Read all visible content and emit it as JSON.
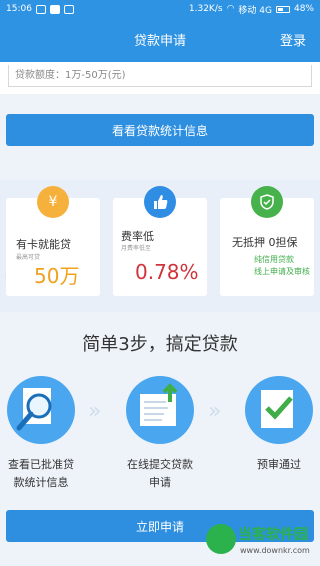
{
  "status_bar": {
    "time": "15:06",
    "network_speed": "1.32K/s",
    "carrier": "移动 4G",
    "battery": "48%"
  },
  "nav": {
    "title": "贷款申请",
    "login": "登录"
  },
  "form": {
    "amount_placeholder": "贷款额度：1万-50万(元)"
  },
  "buttons": {
    "stats": "看看贷款统计信息",
    "apply": "立即申请"
  },
  "features": [
    {
      "title": "有卡就能贷",
      "subtitle": "最高可贷",
      "value": "50万",
      "icon": "yen-coin-icon",
      "color": "#f6b13c"
    },
    {
      "title": "费率低",
      "subtitle": "月费率低至",
      "value": "0.78%",
      "icon": "thumbs-up-icon",
      "color": "#2f8de4"
    },
    {
      "title": "无抵押 0担保",
      "lines": [
        "纯信用贷款",
        "线上申请及审核"
      ],
      "icon": "shield-icon",
      "color": "#47b14b"
    }
  ],
  "steps_title": "简单3步，搞定贷款",
  "steps": [
    {
      "label_lines": [
        "查看已批准贷",
        "款统计信息"
      ],
      "icon": "magnifier-icon"
    },
    {
      "label_lines": [
        "在线提交贷款",
        "申请"
      ],
      "icon": "upload-document-icon"
    },
    {
      "label_lines": [
        "预审通过"
      ],
      "icon": "checkmark-document-icon"
    }
  ],
  "watermark": {
    "name": "当客软件园",
    "url": "www.downkr.com"
  }
}
